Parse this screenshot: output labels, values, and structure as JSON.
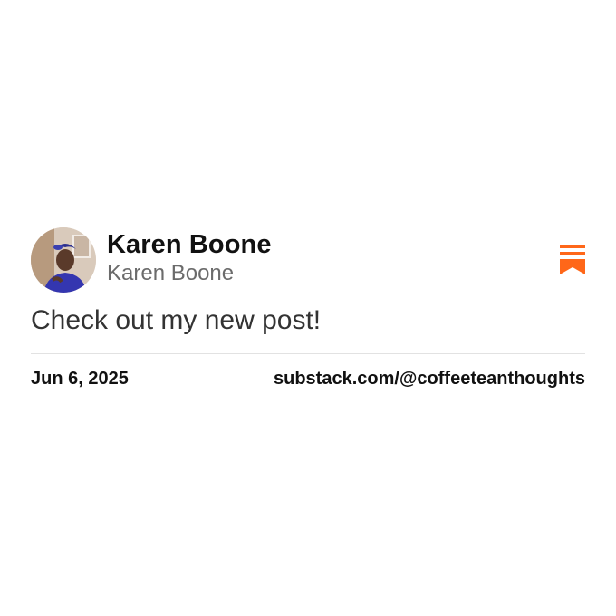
{
  "author": {
    "display_name": "Karen Boone",
    "handle": "Karen Boone",
    "avatar_icon": "profile-photo"
  },
  "post": {
    "text": "Check out my new post!"
  },
  "footer": {
    "date": "Jun 6, 2025",
    "link": "substack.com/@coffeeteanthoughts"
  },
  "brand": {
    "logo_icon": "substack-logo-icon",
    "accent_color": "#FF6719"
  }
}
